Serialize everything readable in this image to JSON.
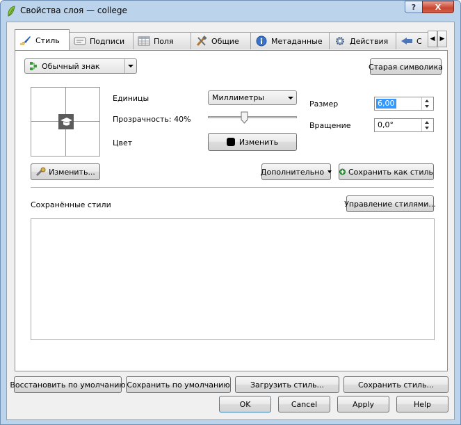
{
  "window": {
    "title": "Свойства слоя — college",
    "help_glyph": "?",
    "close_glyph": "X"
  },
  "tabs": [
    {
      "label": "Стиль",
      "icon": "brush-icon",
      "active": true
    },
    {
      "label": "Подписи",
      "icon": "labels-icon"
    },
    {
      "label": "Поля",
      "icon": "table-icon"
    },
    {
      "label": "Общие",
      "icon": "tools-icon"
    },
    {
      "label": "Метаданные",
      "icon": "info-icon"
    },
    {
      "label": "Действия",
      "icon": "gear-icon"
    },
    {
      "label": "С",
      "icon": "diagram-icon"
    }
  ],
  "style": {
    "renderer_combo": "Обычный знак",
    "old_symbology_button": "Старая символика",
    "units_label": "Единицы",
    "units_value": "Миллиметры",
    "transparency_label": "Прозрачность: 40%",
    "transparency_percent": 40,
    "color_label": "Цвет",
    "color_button": "Изменить",
    "color_swatch": "#000000",
    "size_label": "Размер",
    "size_value": "6,00",
    "rotation_label": "Вращение",
    "rotation_value": "0,0°",
    "change_button": "Изменить...",
    "advanced_button": "Дополнительно",
    "save_as_style_button": "Сохранить как стиль",
    "saved_styles_label": "Сохранённые стили",
    "manage_styles_button": "Управление стилями..."
  },
  "footer": {
    "restore_default": "Восстановить по умолчанию",
    "save_default": "Сохранить по умолчанию",
    "load_style": "Загрузить стиль...",
    "save_style": "Сохранить стиль...",
    "ok": "OK",
    "cancel": "Cancel",
    "apply": "Apply",
    "help": "Help"
  }
}
